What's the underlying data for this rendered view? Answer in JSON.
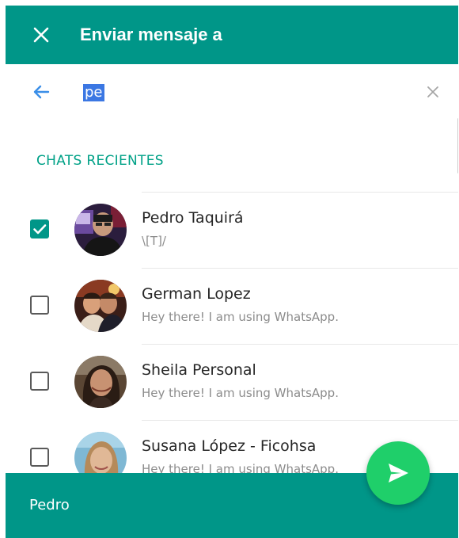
{
  "header": {
    "title": "Enviar mensaje a",
    "close_icon": "close-icon",
    "background_color": "#009688"
  },
  "search": {
    "back_icon": "arrow-back-icon",
    "query": "pe",
    "clear_icon": "clear-icon"
  },
  "section": {
    "title": "CHATS RECIENTES"
  },
  "contacts": [
    {
      "name": "Pedro Taquirá",
      "status": "\\[T]/",
      "checked": true
    },
    {
      "name": "German Lopez",
      "status": "Hey there! I am using WhatsApp.",
      "checked": false
    },
    {
      "name": "Sheila Personal",
      "status": "Hey there! I am using WhatsApp.",
      "checked": false
    },
    {
      "name": "Susana López - Ficohsa",
      "status": "Hey there! I am using WhatsApp.",
      "checked": false
    }
  ],
  "footer": {
    "selected_names": "Pedro"
  },
  "send_button": {
    "icon": "send-icon",
    "color": "#1fcf6a"
  },
  "colors": {
    "accent": "#009688",
    "section_title": "#00a187",
    "back_arrow": "#3a8ee8"
  }
}
